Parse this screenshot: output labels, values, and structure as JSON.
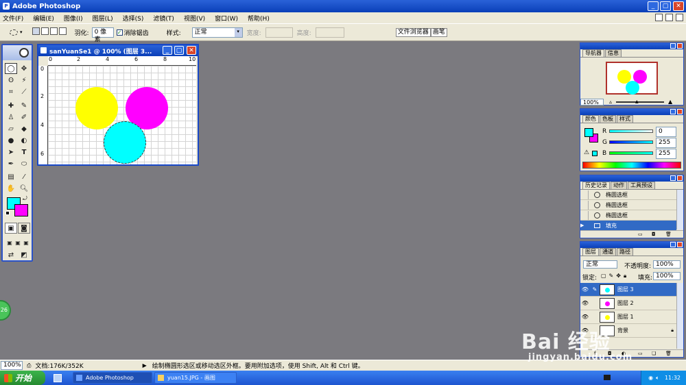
{
  "app": {
    "title": "Adobe Photoshop"
  },
  "menu": [
    "文件(F)",
    "编辑(E)",
    "图像(I)",
    "图层(L)",
    "选择(S)",
    "滤镜(T)",
    "视图(V)",
    "窗口(W)",
    "帮助(H)"
  ],
  "options": {
    "feather_label": "羽化:",
    "feather_value": "0 像素",
    "antialias_label": "消除锯齿",
    "style_label": "样式:",
    "style_value": "正常",
    "width_label": "宽度:",
    "height_label": "高度:",
    "tab_file_browser": "文件浏览器",
    "tab_brushes": "画笔"
  },
  "document": {
    "title": "sanYuanSe1 @ 100% (图层 3...",
    "ruler_top": [
      "0",
      "2",
      "4",
      "6",
      "8",
      "10"
    ],
    "ruler_left": [
      "0",
      "2",
      "4",
      "6"
    ],
    "circles": {
      "yellow": "#ffff00",
      "magenta": "#ff00ff",
      "cyan": "#00ffff"
    }
  },
  "navigator": {
    "tab1": "导航器",
    "tab2": "信息",
    "zoom": "100%"
  },
  "color_panel": {
    "tab1": "颜色",
    "tab2": "色板",
    "tab3": "样式",
    "r_label": "R",
    "g_label": "G",
    "b_label": "B",
    "r_value": "0",
    "g_value": "255",
    "b_value": "255",
    "foreground": "#00ffff",
    "background": "#ff00ff"
  },
  "history": {
    "tab1": "历史记录",
    "tab2": "动作",
    "tab3": "工具预设",
    "items": [
      "椭圆选框",
      "椭圆选框",
      "椭圆选框",
      "填充"
    ]
  },
  "layers": {
    "tab1": "图层",
    "tab2": "通道",
    "tab3": "路径",
    "blend_mode": "正常",
    "opacity_label": "不透明度:",
    "opacity_value": "100%",
    "lock_label": "锁定:",
    "fill_label": "填充:",
    "fill_value": "100%",
    "items": [
      "图层 3",
      "图层 2",
      "图层 1",
      "背景"
    ]
  },
  "status": {
    "zoom": "100%",
    "doc_size": "文档:176K/352K",
    "hint": "绘制椭圆形选区或移动选区外框。要用附加选项，使用 Shift, Alt 和 Ctrl 键。"
  },
  "taskbar": {
    "start": "开始",
    "task1": "Adobe Photoshop",
    "task2": "yuan15.JPG - 画图",
    "clock": "11:32"
  },
  "badge": "26",
  "watermark": {
    "logo": "Bai 经验",
    "url": "jingyan.baidu.com"
  }
}
